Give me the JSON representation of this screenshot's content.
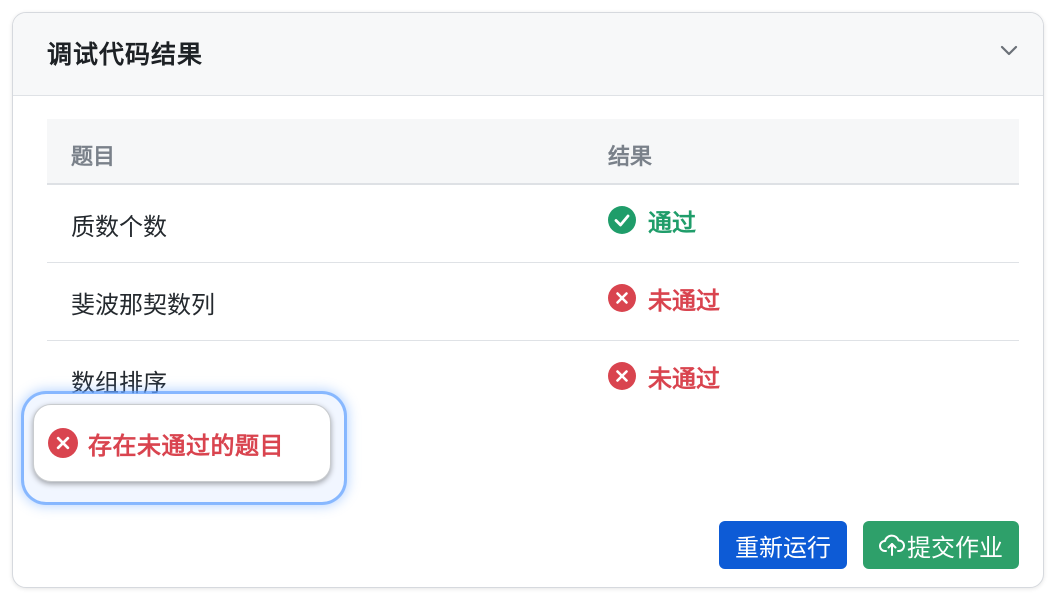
{
  "header": {
    "title": "调试代码结果",
    "collapse_icon": "chevron-down-icon"
  },
  "table": {
    "columns": [
      "题目",
      "结果"
    ],
    "rows": [
      {
        "problem": "质数个数",
        "result": "通过",
        "status": "pass",
        "icon": "check-circle-icon"
      },
      {
        "problem": "斐波那契数列",
        "result": "未通过",
        "status": "fail",
        "icon": "x-circle-icon"
      },
      {
        "problem": "数组排序",
        "result": "未通过",
        "status": "fail",
        "icon": "x-circle-icon"
      }
    ]
  },
  "alert": {
    "text": "存在未通过的题目",
    "icon": "x-circle-icon"
  },
  "actions": {
    "rerun_label": "重新运行",
    "submit_label": "提交作业",
    "submit_icon": "cloud-upload-icon"
  },
  "colors": {
    "pass": "#1f9d6a",
    "fail": "#d9444f",
    "primary": "#0d5bd6",
    "success": "#2ea06a"
  }
}
